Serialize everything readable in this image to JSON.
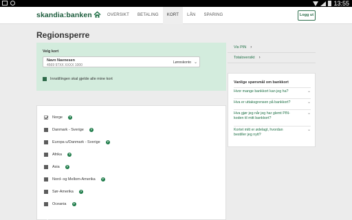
{
  "status": {
    "time": "13:55"
  },
  "header": {
    "logo_left": "skandia",
    "logo_colon": ":",
    "logo_right": "banken",
    "nav": [
      {
        "label": "OVERSIKT",
        "active": false
      },
      {
        "label": "BETALING",
        "active": false
      },
      {
        "label": "KORT",
        "active": true
      },
      {
        "label": "LÅN",
        "active": false
      },
      {
        "label": "SPARING",
        "active": false
      }
    ],
    "logout_label": "Logg ut"
  },
  "page": {
    "title": "Regionsperre"
  },
  "card_select": {
    "label": "Velg kort",
    "name": "Navn Navnesen",
    "number": "4569 97XX XXXX 1000",
    "type": "Lønnskonto",
    "apply_all_label": "Innstillingen skal gjelde alle mine kort",
    "apply_all_checked": true
  },
  "regions": [
    {
      "name": "Norge",
      "checked": true
    },
    {
      "name": "Danmark - Sverige",
      "checked": false
    },
    {
      "name": "Europa u/Danmark - Sverige",
      "checked": false
    },
    {
      "name": "Afrika",
      "checked": false
    },
    {
      "name": "Asia",
      "checked": false
    },
    {
      "name": "Nord- og Mellom-Amerika",
      "checked": false
    },
    {
      "name": "Sør-Amerika",
      "checked": false
    },
    {
      "name": "Oceania",
      "checked": false
    }
  ],
  "side_links": [
    {
      "label": "Vis PIN"
    },
    {
      "label": "Totaloversikt"
    }
  ],
  "faq": {
    "title": "Vanlige spørsmål om bankkort",
    "items": [
      {
        "line1": "Hvor mange bankkort kan jeg ha?",
        "line2": ""
      },
      {
        "line1": "Hva er uttaksgrensen på bankkort?",
        "line2": ""
      },
      {
        "line1": "Hva gjør jeg når jeg har glemt PIN-",
        "line2": "koden til mitt bankkort?"
      },
      {
        "line1": "Kortet mitt er ødelagt, hvordan",
        "line2": "bestiller jeg nytt?"
      }
    ]
  },
  "colors": {
    "brand_green": "#1c5c3c",
    "panel_green": "#d3ecdd",
    "link_green": "#1c6e43"
  }
}
